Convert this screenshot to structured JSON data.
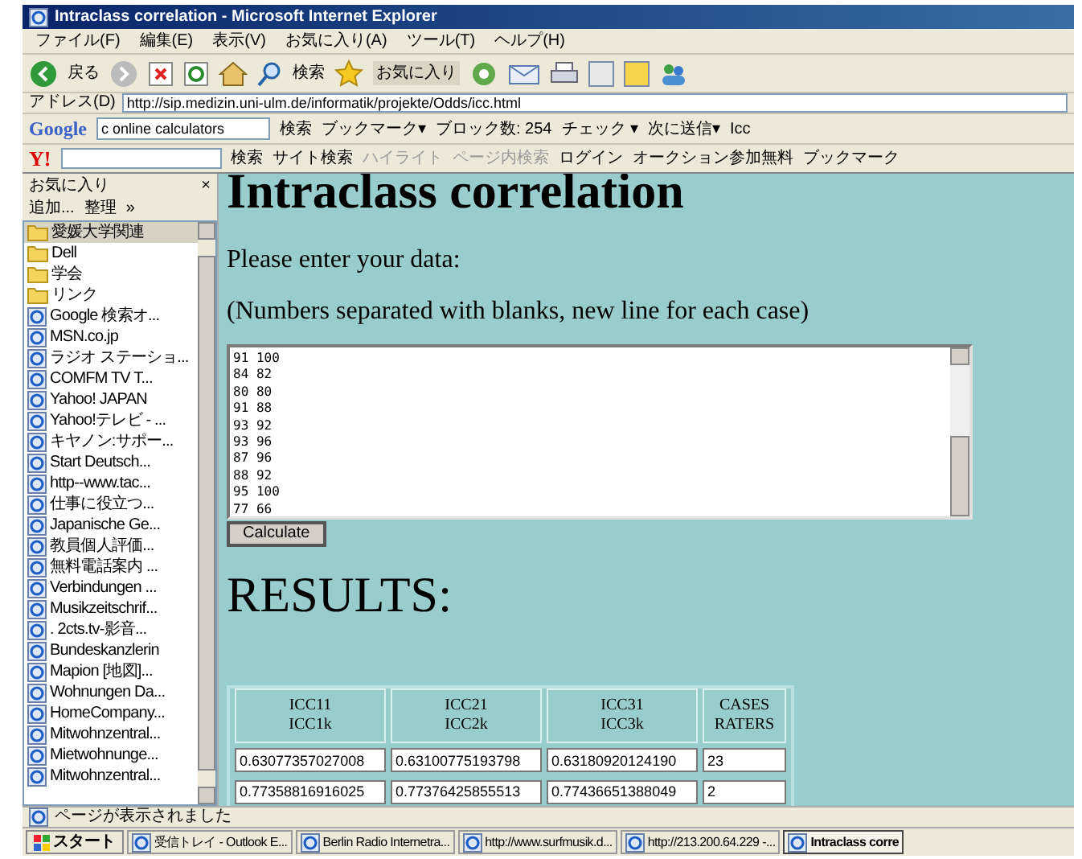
{
  "window": {
    "title": "Intraclass correlation - Microsoft Internet Explorer"
  },
  "menu": [
    "ファイル(F)",
    "編集(E)",
    "表示(V)",
    "お気に入り(A)",
    "ツール(T)",
    "ヘルプ(H)"
  ],
  "toolbar": {
    "back": "戻る",
    "search": "検索",
    "favorites": "お気に入り"
  },
  "address": {
    "label": "アドレス(D)",
    "value": "http://sip.medizin.uni-ulm.de/informatik/projekte/Odds/icc.html"
  },
  "google_bar": {
    "logo": "Google",
    "query": "c online calculators",
    "items": [
      {
        "label": "検索",
        "disabled": false
      },
      {
        "label": "ブックマーク▾",
        "disabled": false
      },
      {
        "label": "ブロック数: 254",
        "disabled": false
      },
      {
        "label": "チェック ▾",
        "disabled": false
      },
      {
        "label": "次に送信▾",
        "disabled": false
      },
      {
        "label": "Icc",
        "disabled": false
      }
    ]
  },
  "yahoo_bar": {
    "logo": "Y!",
    "items": [
      {
        "label": "検索",
        "disabled": false
      },
      {
        "label": "サイト検索",
        "disabled": false
      },
      {
        "label": "ハイライト",
        "disabled": true
      },
      {
        "label": "ページ内検索",
        "disabled": true
      },
      {
        "label": "ログイン",
        "disabled": false
      },
      {
        "label": "オークション参加無料",
        "disabled": false
      },
      {
        "label": "ブックマーク",
        "disabled": false
      }
    ]
  },
  "sidebar": {
    "title": "お気に入り",
    "close": "×",
    "add": "追加...",
    "organize": "整理",
    "more": "»",
    "items": [
      {
        "kind": "folder",
        "label": "愛媛大学関連",
        "selected": true
      },
      {
        "kind": "folder",
        "label": "Dell",
        "selected": false
      },
      {
        "kind": "folder",
        "label": "学会",
        "selected": false
      },
      {
        "kind": "folder",
        "label": "リンク",
        "selected": false
      },
      {
        "kind": "link",
        "label": "Google 検索オ...",
        "selected": false
      },
      {
        "kind": "link",
        "label": "MSN.co.jp",
        "selected": false
      },
      {
        "kind": "link",
        "label": "ラジオ ステーショ...",
        "selected": false
      },
      {
        "kind": "link",
        "label": "COMFM TV  T...",
        "selected": false
      },
      {
        "kind": "link",
        "label": "Yahoo! JAPAN",
        "selected": false
      },
      {
        "kind": "link",
        "label": "Yahoo!テレビ - ...",
        "selected": false
      },
      {
        "kind": "link",
        "label": "キヤノン:サポー...",
        "selected": false
      },
      {
        "kind": "link",
        "label": "Start  Deutsch...",
        "selected": false
      },
      {
        "kind": "link",
        "label": "http--www.tac...",
        "selected": false
      },
      {
        "kind": "link",
        "label": "仕事に役立つ...",
        "selected": false
      },
      {
        "kind": "link",
        "label": "Japanische Ge...",
        "selected": false
      },
      {
        "kind": "link",
        "label": "教員個人評価...",
        "selected": false
      },
      {
        "kind": "link",
        "label": "無料電話案内 ...",
        "selected": false
      },
      {
        "kind": "link",
        "label": "Verbindungen ...",
        "selected": false
      },
      {
        "kind": "link",
        "label": "Musikzeitschrif...",
        "selected": false
      },
      {
        "kind": "link",
        "label": ". 2cts.tv-影音...",
        "selected": false
      },
      {
        "kind": "link",
        "label": "Bundeskanzlerin",
        "selected": false
      },
      {
        "kind": "link",
        "label": "Mapion [地図]...",
        "selected": false
      },
      {
        "kind": "link",
        "label": "Wohnungen Da...",
        "selected": false
      },
      {
        "kind": "link",
        "label": "HomeCompany...",
        "selected": false
      },
      {
        "kind": "link",
        "label": "Mitwohnzentral...",
        "selected": false
      },
      {
        "kind": "link",
        "label": "Mietwohnunge...",
        "selected": false
      },
      {
        "kind": "link",
        "label": "Mitwohnzentral...",
        "selected": false
      }
    ]
  },
  "page": {
    "heading": "Intraclass correlation",
    "prompt": "Please enter your data:",
    "hint": "(Numbers separated with blanks, new line for each case)",
    "data_lines": [
      "91 100",
      "84 82",
      "80 80",
      "91 88",
      "93 92",
      "93 96",
      "87 96",
      "88 92",
      "95 100",
      "77 66"
    ],
    "calculate": "Calculate",
    "results_heading": "RESULTS:",
    "results_table": {
      "header_rows": [
        [
          "ICC11",
          "ICC21",
          "ICC31",
          "CASES"
        ],
        [
          "ICC1k",
          "ICC2k",
          "ICC3k",
          "RATERS"
        ]
      ],
      "rows": [
        [
          "0.63077357027008",
          "0.63100775193798",
          "0.63180920124190",
          "23"
        ],
        [
          "0.77358816916025",
          "0.77376425855513",
          "0.77436651388049",
          "2"
        ]
      ]
    }
  },
  "status_bar": "ページが表示されました",
  "taskbar": {
    "start": "スタート",
    "tasks": [
      {
        "label": "受信トレイ - Outlook E...",
        "selected": false
      },
      {
        "label": "Berlin Radio Internetra...",
        "selected": false
      },
      {
        "label": "http://www.surfmusik.d...",
        "selected": false
      },
      {
        "label": "http://213.200.64.229 -...",
        "selected": false
      },
      {
        "label": "Intraclass corre",
        "selected": true
      }
    ]
  }
}
